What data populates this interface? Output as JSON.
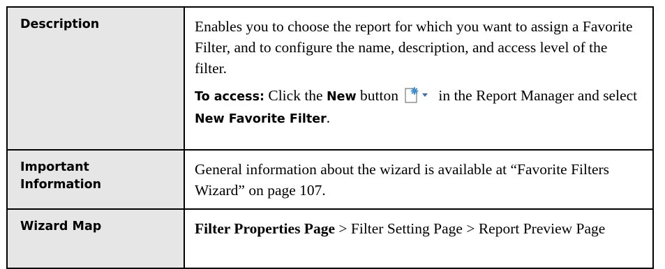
{
  "rows": [
    {
      "label": "Description",
      "paragraph1": "Enables you to choose the report for which you want to assign a Favorite Filter, and to configure the name, description, and access level of the filter.",
      "access_prefix": "To access:",
      "access_text1": " Click the ",
      "access_new": "New",
      "access_text2": " button",
      "access_text3": " in the Report Manager and select ",
      "access_target": "New Favorite Filter",
      "access_end": "."
    },
    {
      "label_line1": "Important",
      "label_line2": "Information",
      "text": "General information about the wizard is available at “Favorite Filters Wizard” on page 107."
    },
    {
      "label": "Wizard Map",
      "step1": "Filter Properties Page",
      "sep1": " > ",
      "step2": "Filter Setting Page",
      "sep2": " > ",
      "step3": "Report Preview Page"
    }
  ],
  "icons": {
    "new_button_icon": "new-document-star-with-dropdown"
  },
  "colors": {
    "label_background": "#e6e6e6",
    "border": "#000000",
    "icon_star": "#3a8fd6"
  }
}
